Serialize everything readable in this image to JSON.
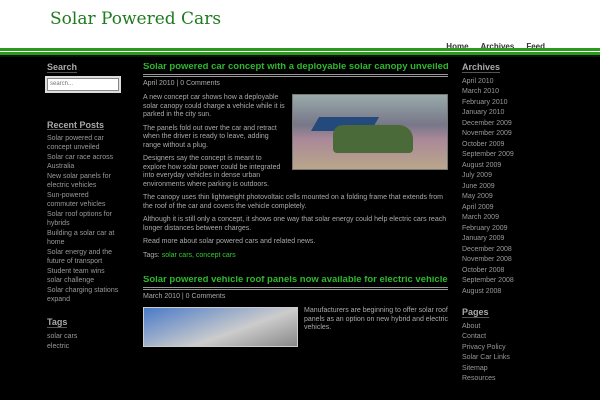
{
  "header": {
    "title": "Solar Powered Cars",
    "nav": [
      "Home",
      "Archives",
      "Feed"
    ]
  },
  "left": {
    "search_title": "Search",
    "search_placeholder": "search...",
    "recent_title": "Recent Posts",
    "recent": [
      "Solar powered car concept unveiled",
      "Solar car race across Australia",
      "New solar panels for electric vehicles",
      "Sun-powered commuter vehicles",
      "Solar roof options for hybrids",
      "Building a solar car at home",
      "Solar energy and the future of transport",
      "Student team wins solar challenge",
      "Solar charging stations expand"
    ],
    "tags_title": "Tags",
    "tags": [
      "solar cars",
      "electric"
    ]
  },
  "main": {
    "posts": [
      {
        "title": "Solar powered car concept with a deployable solar canopy unveiled",
        "meta": "April 2010 | 0 Comments",
        "paragraphs": [
          "A new concept car shows how a deployable solar canopy could charge a vehicle while it is parked in the city sun.",
          "The panels fold out over the car and retract when the driver is ready to leave, adding range without a plug.",
          "Designers say the concept is meant to explore how solar power could be integrated into everyday vehicles in dense urban environments where parking is outdoors.",
          "The canopy uses thin lightweight photovoltaic cells mounted on a folding frame that extends from the roof of the car and covers the vehicle completely.",
          "Although it is still only a concept, it shows one way that solar energy could help electric cars reach longer distances between charges.",
          "Read more about solar powered cars and related news."
        ],
        "tags_label": "Tags:",
        "tags": "solar cars, concept cars"
      },
      {
        "title": "Solar powered vehicle roof panels now available for electric vehicles",
        "meta": "March 2010 | 0 Comments",
        "paragraphs": [
          "Manufacturers are beginning to offer solar roof panels as an option on new hybrid and electric vehicles."
        ]
      }
    ]
  },
  "right": {
    "archives_title": "Archives",
    "archives": [
      "April 2010",
      "March 2010",
      "February 2010",
      "January 2010",
      "December 2009",
      "November 2009",
      "October 2009",
      "September 2009",
      "August 2009",
      "July 2009",
      "June 2009",
      "May 2009",
      "April 2009",
      "March 2009",
      "February 2009",
      "January 2009",
      "December 2008",
      "November 2008",
      "October 2008",
      "September 2008",
      "August 2008"
    ],
    "pages_title": "Pages",
    "pages": [
      "About",
      "Contact",
      "Privacy Policy",
      "Solar Car Links",
      "Sitemap",
      "Resources"
    ]
  }
}
